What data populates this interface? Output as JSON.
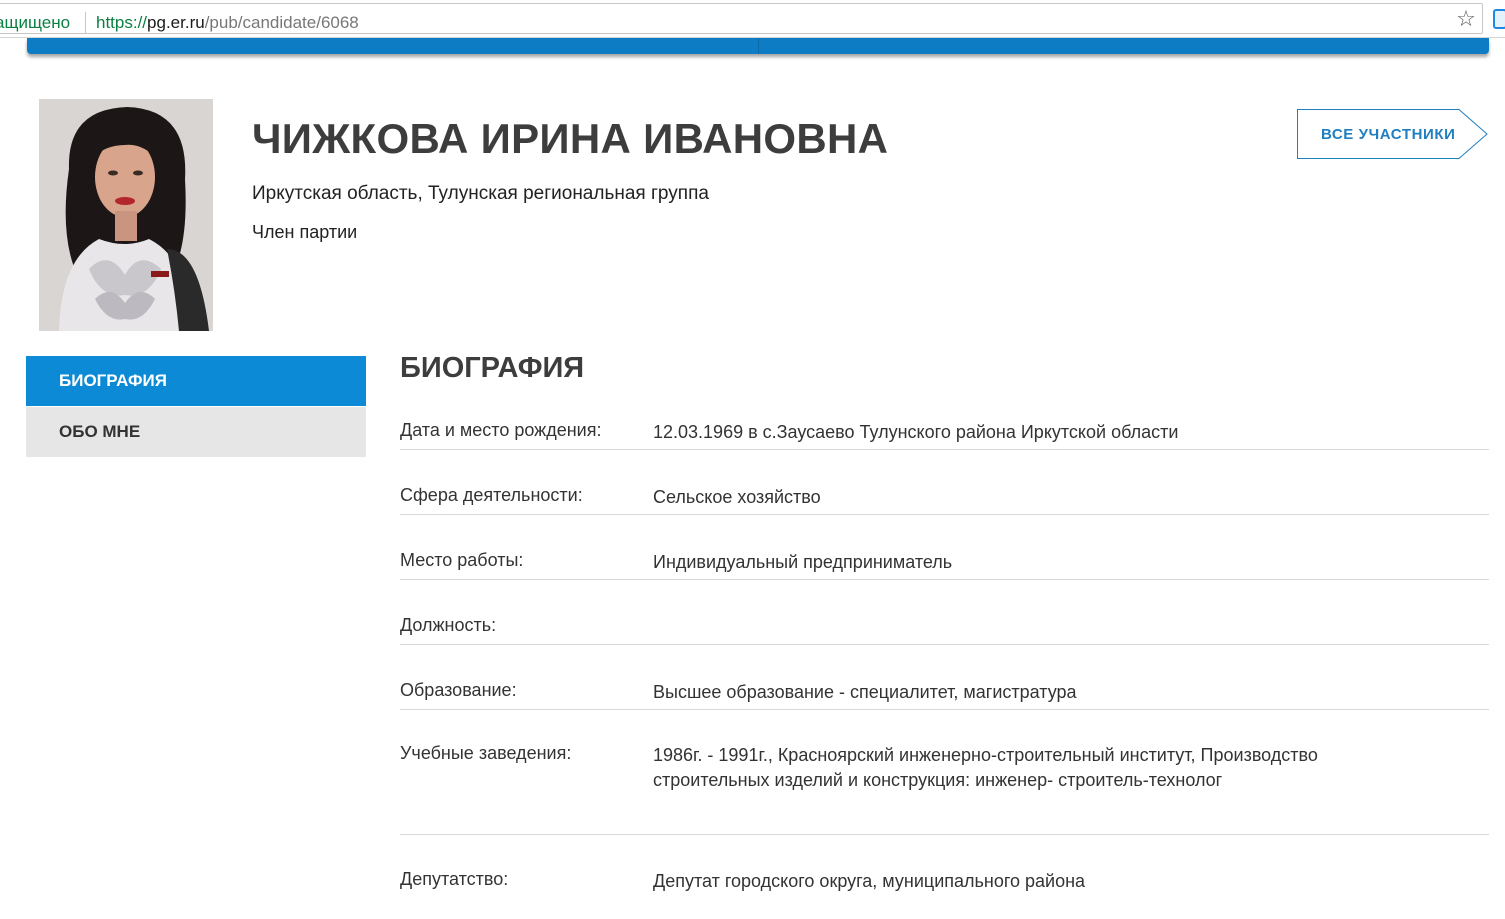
{
  "browser": {
    "security_label": "ащищено",
    "url_scheme": "https://",
    "url_domain": "pg.er.ru",
    "url_path": "/pub/candidate/6068"
  },
  "candidate": {
    "name": "ЧИЖКОВА ИРИНА ИВАНОВНА",
    "region": "Иркутская область, Тулунская региональная группа",
    "status": "Член партии",
    "all_participants_label": "ВСЕ УЧАСТНИКИ"
  },
  "tabs": [
    {
      "label": "БИОГРАФИЯ",
      "active": true
    },
    {
      "label": "ОБО МНЕ",
      "active": false
    }
  ],
  "biography": {
    "title": "БИОГРАФИЯ",
    "rows": [
      {
        "label": "Дата и место рождения:",
        "value": "12.03.1969 в с.Заусаево Тулунского района Иркутской области"
      },
      {
        "label": "Сфера деятельности:",
        "value": "Сельское хозяйство"
      },
      {
        "label": "Место работы:",
        "value": "Индивидуальный предприниматель"
      },
      {
        "label": "Должность:",
        "value": ""
      },
      {
        "label": "Образование:",
        "value": "Высшее образование - специалитет, магистратура"
      },
      {
        "label": "Учебные заведения:",
        "value": "1986г. - 1991г., Красноярский инженерно-строительный институт, Производство строительных изделий и конструкция: инженер- строитель-технолог"
      },
      {
        "label": "Депутатство:",
        "value": "Депутат городского округа, муниципального района"
      }
    ]
  },
  "colors": {
    "accent_blue": "#0d8ad6",
    "nav_blue": "#0d7cc4",
    "link_blue": "#1f7fc0"
  }
}
